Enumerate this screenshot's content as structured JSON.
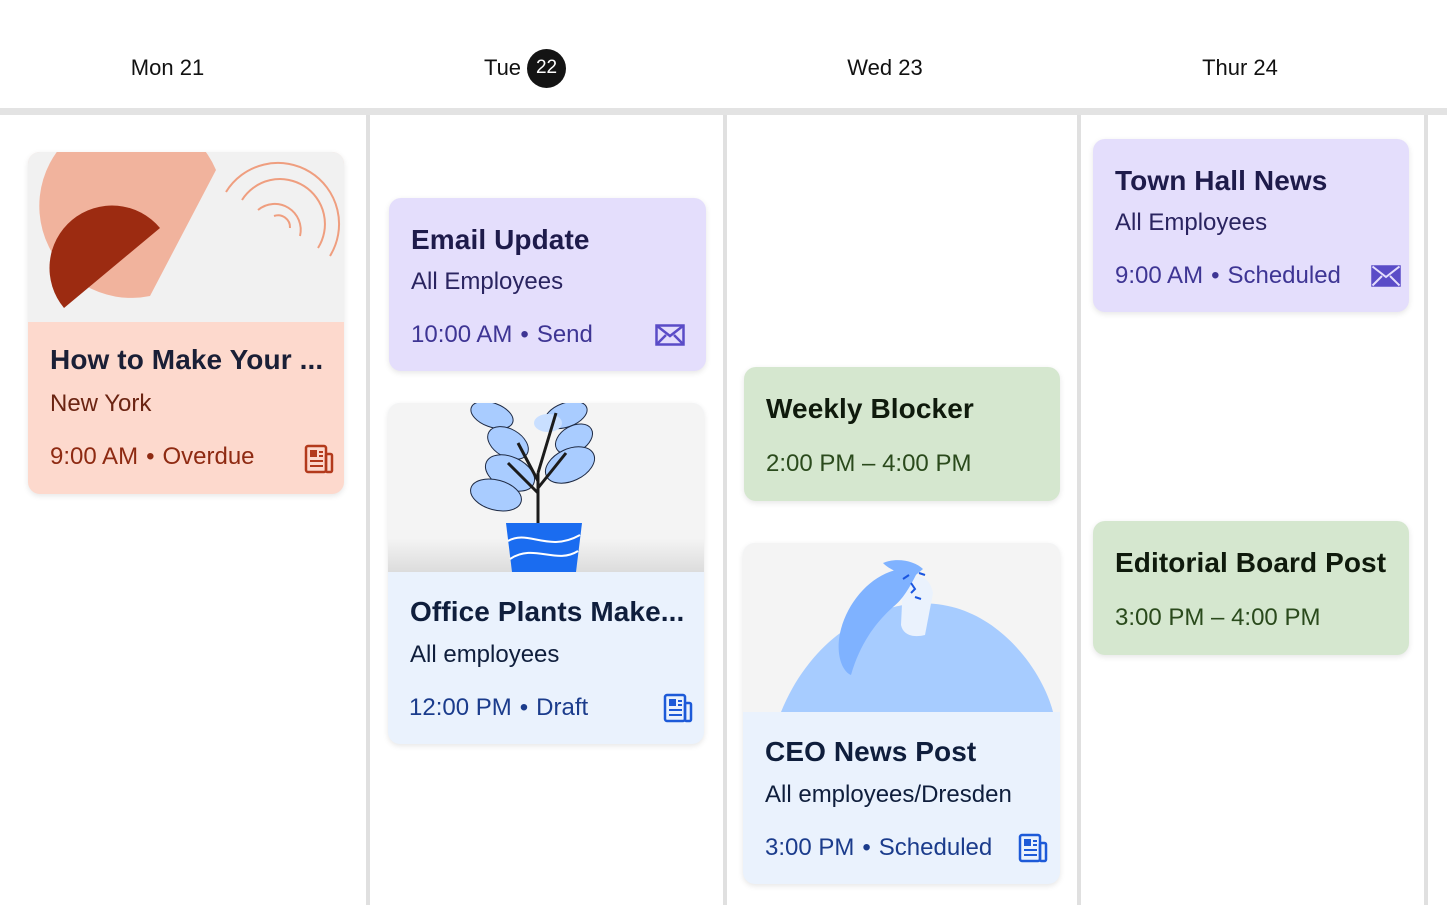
{
  "days": [
    {
      "label": "Mon 21",
      "num": "",
      "today": false
    },
    {
      "label": "Tue",
      "num": "22",
      "today": true
    },
    {
      "label": "Wed 23",
      "num": "",
      "today": false
    },
    {
      "label": "Thur 24",
      "num": "",
      "today": false
    }
  ],
  "events": {
    "how_to": {
      "title": "How to Make Your ...",
      "audience": "New York",
      "time": "9:00 AM",
      "status": "Overdue",
      "icon": "newspaper-icon",
      "color": "#9a2c14"
    },
    "email_update": {
      "title": "Email Update",
      "audience": "All Employees",
      "time": "10:00 AM",
      "status": "Send",
      "icon": "envelope-icon",
      "color": "#4a3e9c"
    },
    "office_plants": {
      "title": "Office Plants Make...",
      "audience": "All employees",
      "time": "12:00 PM",
      "status": "Draft",
      "icon": "newspaper-icon",
      "color": "#1b3c8c"
    },
    "weekly_blocker": {
      "title": "Weekly Blocker",
      "time_range": "2:00 PM – 4:00 PM",
      "color": "#2c4a1f"
    },
    "ceo_news": {
      "title": "CEO News Post",
      "audience": "All employees/Dresden",
      "time": "3:00 PM",
      "status": "Scheduled",
      "icon": "newspaper-icon",
      "color": "#1b3c8c"
    },
    "town_hall": {
      "title": "Town Hall News",
      "audience": "All Employees",
      "time": "9:00 AM",
      "status": "Scheduled",
      "icon": "envelope-icon",
      "color": "#4a3e9c"
    },
    "editorial": {
      "title": "Editorial Board Post",
      "time_range": "3:00 PM – 4:00 PM",
      "color": "#2c4a1f"
    }
  }
}
